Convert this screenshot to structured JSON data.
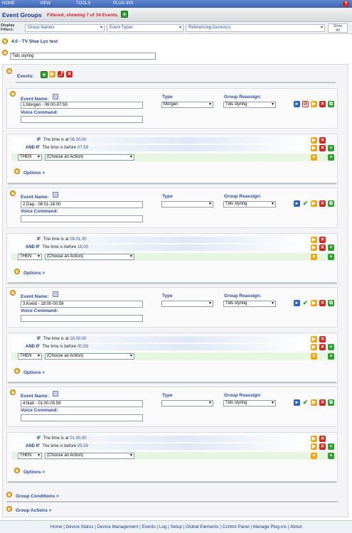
{
  "menu": {
    "items": [
      "HOME",
      "VIEW",
      "TOOLS",
      "PLUG-INS"
    ]
  },
  "header": {
    "title": "Event Groups",
    "filter_status": "Filtered, showing 7 of 34 Events."
  },
  "filters": {
    "label_line1": "Display",
    "label_line2": "Filters:",
    "group_names": "Group Names",
    "event_types": "Event Types",
    "referencing_devices": "Referencing Device(s)",
    "show_all_line1": "Show",
    "show_all_line2": "All"
  },
  "group": {
    "name": "4.0 - TV Stue Lys test",
    "group_field": "Tids styring",
    "events_label": "Events:",
    "group_conditions": "Group Conditions >",
    "group_actions": "Group Actions >"
  },
  "labels": {
    "event_name": "Event Name:",
    "type": "Type",
    "group_reassign": "Group Reassign:",
    "voice_command": "Voice Command:",
    "if": "IF",
    "and_if": "AND IF",
    "then": "THEN",
    "choose_action": "(Choose an Action)",
    "options": "Options >",
    "time_at": "The time is at",
    "time_before": "The time is before"
  },
  "events": [
    {
      "name": "1.Morgen - 06:00-07:59",
      "type": "Morgen",
      "reassign": "Tids styring",
      "if_time": "06.00.00",
      "before_time": "07.59"
    },
    {
      "name": "2.Dag - 08:01-18:00",
      "type": "",
      "reassign": "Tids styring",
      "if_time": "08.01.00",
      "before_time": "18.00"
    },
    {
      "name": "3.Kveld - 18:00-00:59",
      "type": "",
      "reassign": "Tids styring",
      "if_time": "18.00.00",
      "before_time": "00.59"
    },
    {
      "name": "4.Natt - 01:00-05:59",
      "type": "",
      "reassign": "Tids styring",
      "if_time": "01.00.00",
      "before_time": "05.59"
    }
  ],
  "footer": {
    "links": [
      "Home",
      "Device Status",
      "Device Management",
      "Events",
      "Log",
      "Setup",
      "Global Elements",
      "Control Panel",
      "Manage Plug-ins",
      "About"
    ],
    "separator": " | "
  },
  "colors": {
    "menubar": "#4a72bf",
    "accent_red": "#d3241e",
    "link_blue": "#1a3a8a",
    "green": "#2e9e2e",
    "orange": "#f0a513"
  }
}
